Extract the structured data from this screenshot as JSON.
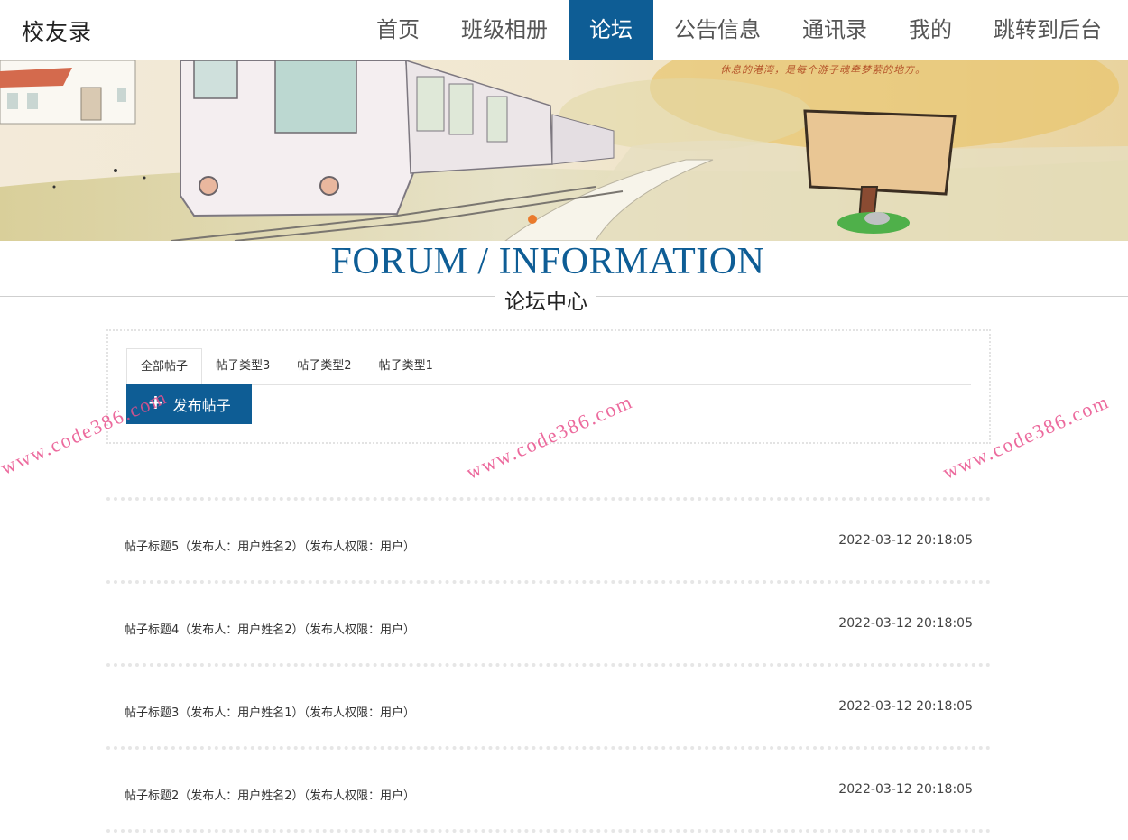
{
  "header": {
    "logo": "校友录",
    "nav": [
      {
        "label": "首页",
        "active": false
      },
      {
        "label": "班级相册",
        "active": false
      },
      {
        "label": "论坛",
        "active": true
      },
      {
        "label": "公告信息",
        "active": false
      },
      {
        "label": "通讯录",
        "active": false
      },
      {
        "label": "我的",
        "active": false
      },
      {
        "label": "跳转到后台",
        "active": false
      }
    ]
  },
  "banner": {
    "slogan": "休息的港湾，是每个游子魂牵梦萦的地方。"
  },
  "section": {
    "title_en": "FORUM / INFORMATION",
    "title_cn": "论坛中心"
  },
  "tabs": [
    {
      "label": "全部帖子",
      "active": true
    },
    {
      "label": "帖子类型3",
      "active": false
    },
    {
      "label": "帖子类型2",
      "active": false
    },
    {
      "label": "帖子类型1",
      "active": false
    }
  ],
  "publish_button": {
    "label": "发布帖子",
    "icon": "plus-icon"
  },
  "posts": [
    {
      "title": "帖子标题5（发布人：用户姓名2）（发布人权限：用户）",
      "time": "2022-03-12 20:18:05"
    },
    {
      "title": "帖子标题4（发布人：用户姓名2）（发布人权限：用户）",
      "time": "2022-03-12 20:18:05"
    },
    {
      "title": "帖子标题3（发布人：用户姓名1）（发布人权限：用户）",
      "time": "2022-03-12 20:18:05"
    },
    {
      "title": "帖子标题2（发布人：用户姓名2）（发布人权限：用户）",
      "time": "2022-03-12 20:18:05"
    }
  ],
  "watermark": "www.code386.com",
  "colors": {
    "accent": "#0e5d95",
    "carousel_dot": "#ea7a2c",
    "watermark": "#e9508c"
  }
}
